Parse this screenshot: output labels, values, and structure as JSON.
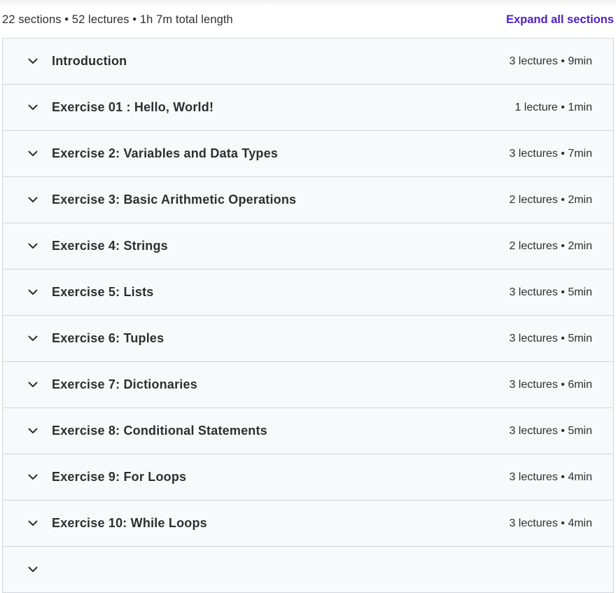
{
  "header": {
    "summary": "22 sections • 52 lectures • 1h 7m total length",
    "expand_label": "Expand all sections"
  },
  "icons": {
    "section_toggle": "chevron-down-icon"
  },
  "colors": {
    "accent": "#5022c3",
    "section_bg": "#f7f9fa",
    "border": "#d1d7dc",
    "text": "#2d2f31"
  },
  "sections": [
    {
      "title": "Introduction",
      "meta": "3 lectures • 9min"
    },
    {
      "title": "Exercise 01 : Hello, World!",
      "meta": "1 lecture • 1min"
    },
    {
      "title": "Exercise 2: Variables and Data Types",
      "meta": "3 lectures • 7min"
    },
    {
      "title": "Exercise 3: Basic Arithmetic Operations",
      "meta": "2 lectures • 2min"
    },
    {
      "title": "Exercise 4: Strings",
      "meta": "2 lectures • 2min"
    },
    {
      "title": "Exercise 5: Lists",
      "meta": "3 lectures • 5min"
    },
    {
      "title": "Exercise 6: Tuples",
      "meta": "3 lectures • 5min"
    },
    {
      "title": "Exercise 7: Dictionaries",
      "meta": "3 lectures • 6min"
    },
    {
      "title": "Exercise 8: Conditional Statements",
      "meta": "3 lectures • 5min"
    },
    {
      "title": "Exercise 9: For Loops",
      "meta": "3 lectures • 4min"
    },
    {
      "title": "Exercise 10: While Loops",
      "meta": "3 lectures • 4min"
    },
    {
      "title": "",
      "meta": ""
    }
  ]
}
